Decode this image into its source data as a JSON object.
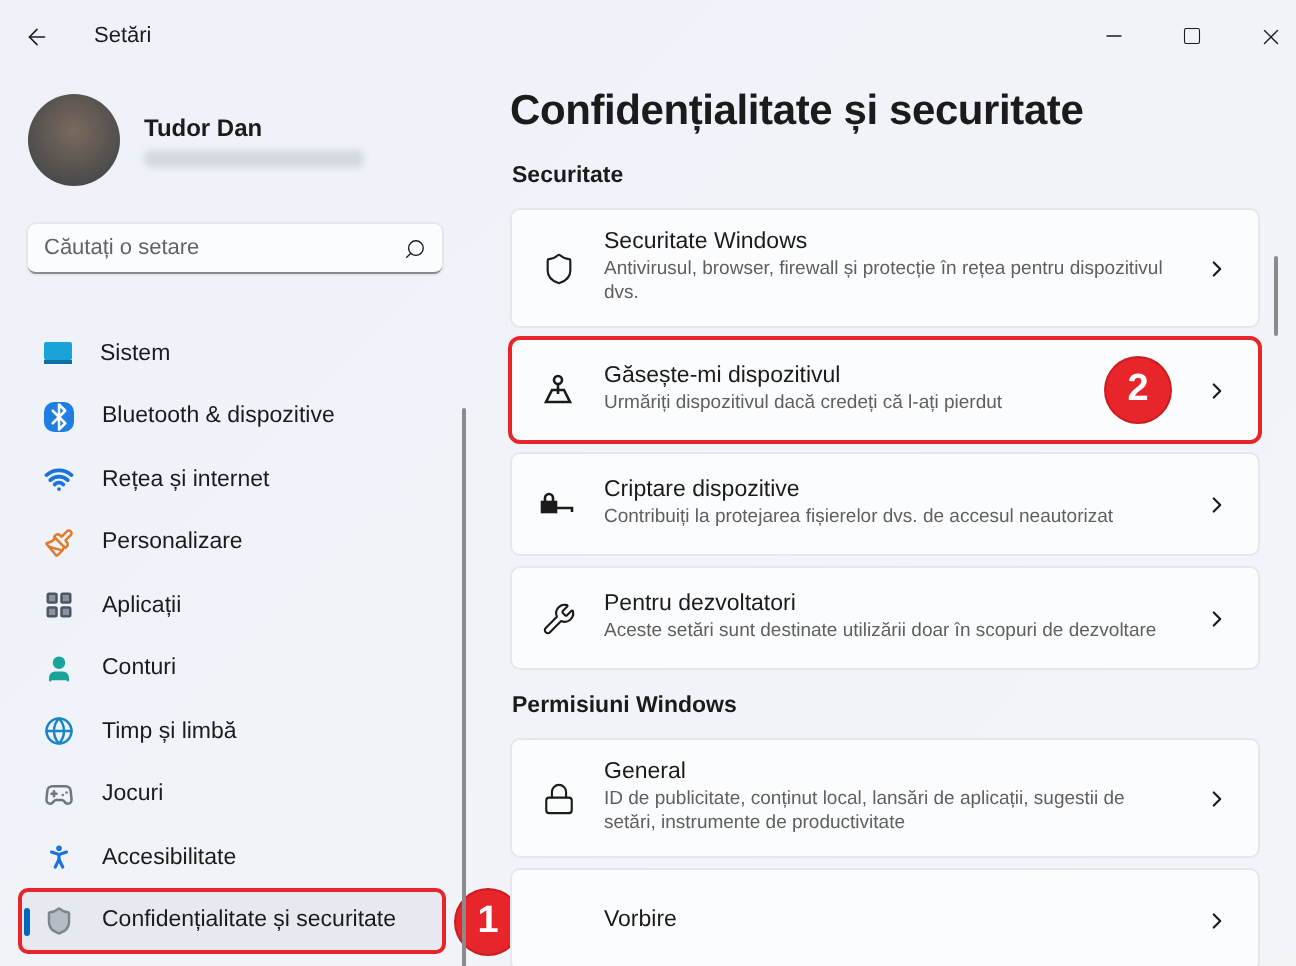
{
  "window": {
    "title": "Setări"
  },
  "account": {
    "name": "Tudor Dan"
  },
  "search": {
    "placeholder": "Căutați o setare"
  },
  "sidebar": {
    "items": [
      {
        "label": "Sistem",
        "selected": false
      },
      {
        "label": "Bluetooth & dispozitive",
        "selected": false
      },
      {
        "label": "Rețea și internet",
        "selected": false
      },
      {
        "label": "Personalizare",
        "selected": false
      },
      {
        "label": "Aplicații",
        "selected": false
      },
      {
        "label": "Conturi",
        "selected": false
      },
      {
        "label": "Timp și limbă",
        "selected": false
      },
      {
        "label": "Jocuri",
        "selected": false
      },
      {
        "label": "Accesibilitate",
        "selected": false
      },
      {
        "label": "Confidențialitate și securitate",
        "selected": true,
        "callout": "1"
      }
    ]
  },
  "page": {
    "title": "Confidențialitate și securitate",
    "sections": [
      {
        "heading": "Securitate",
        "cards": [
          {
            "title": "Securitate Windows",
            "description": "Antivirusul, browser, firewall și protecție în rețea pentru dispozitivul dvs."
          },
          {
            "title": "Găsește-mi dispozitivul",
            "description": "Urmăriți dispozitivul dacă credeți că l-ați pierdut",
            "callout": "2"
          },
          {
            "title": "Criptare dispozitive",
            "description": "Contribuiți la protejarea fișierelor dvs. de accesul neautorizat"
          },
          {
            "title": "Pentru dezvoltatori",
            "description": "Aceste setări sunt destinate utilizării doar în scopuri de dezvoltare"
          }
        ]
      },
      {
        "heading": "Permisiuni Windows",
        "cards": [
          {
            "title": "General",
            "description": "ID de publicitate, conținut local, lansări de aplicații, sugestii de setări, instrumente de productivitate"
          },
          {
            "title": "Vorbire"
          }
        ]
      }
    ]
  }
}
